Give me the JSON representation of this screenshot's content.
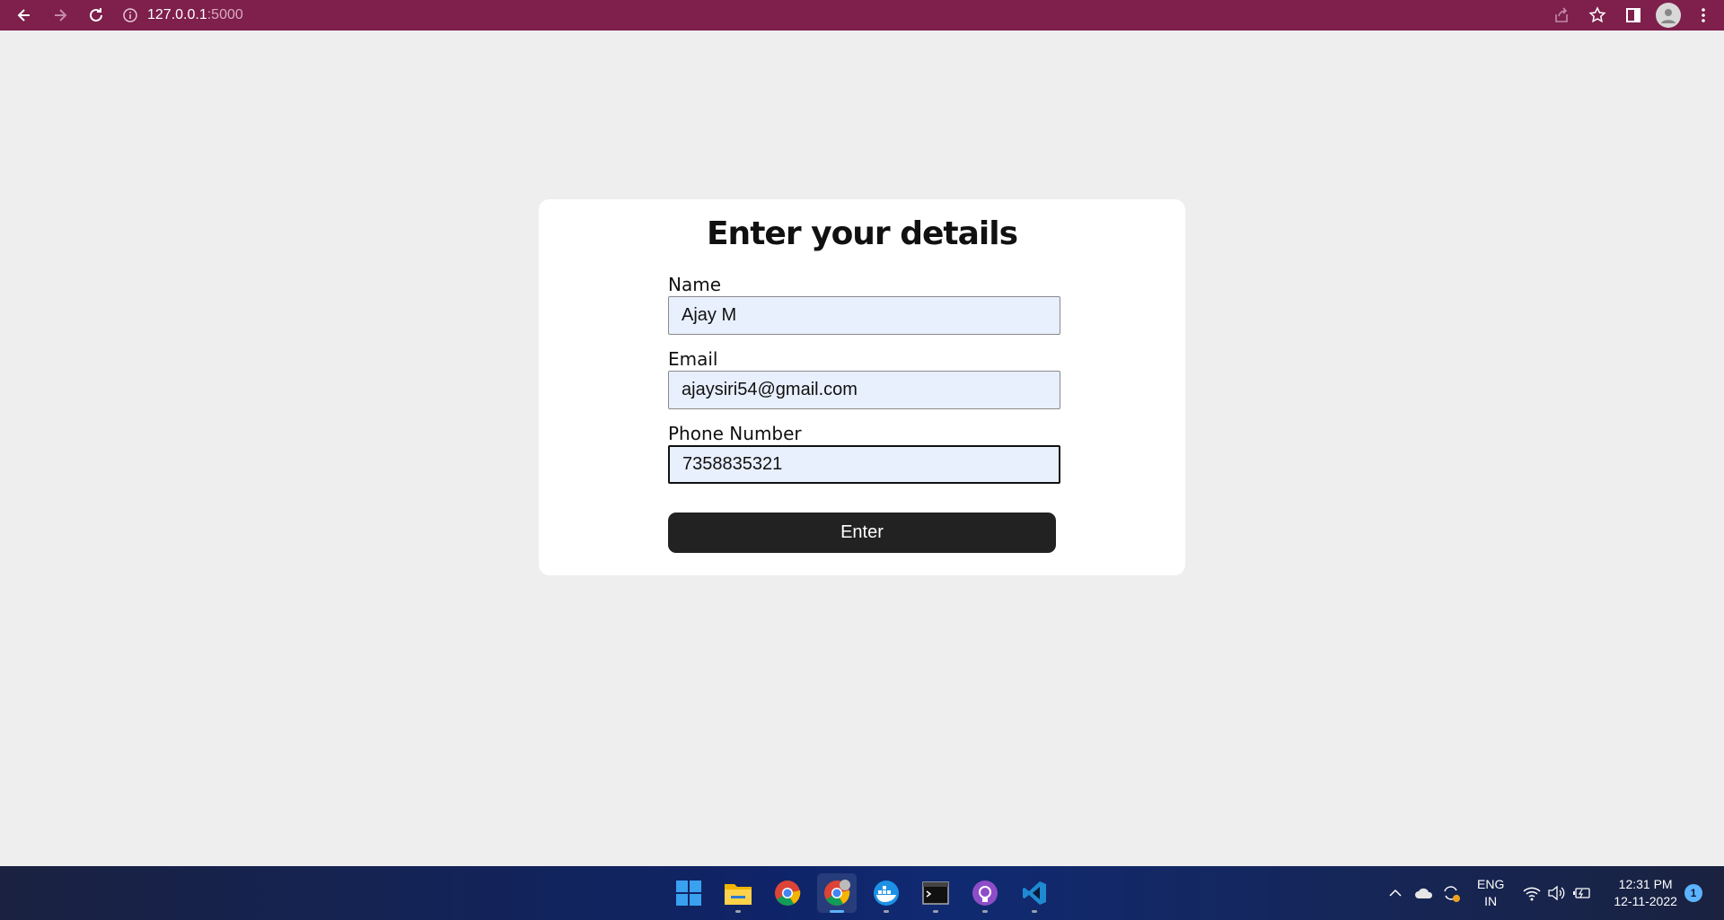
{
  "browser": {
    "url_host": "127.0.0.1",
    "url_port": ":5000"
  },
  "form": {
    "title": "Enter your details",
    "fields": [
      {
        "label": "Name",
        "value": "Ajay M"
      },
      {
        "label": "Email",
        "value": "ajaysiri54@gmail.com"
      },
      {
        "label": "Phone Number",
        "value": "7358835321"
      }
    ],
    "submit_label": "Enter"
  },
  "taskbar": {
    "apps": [
      "start-icon",
      "file-explorer-icon",
      "chrome-icon",
      "chrome-profile-icon",
      "docker-icon",
      "terminal-icon",
      "github-desktop-icon",
      "vscode-icon"
    ],
    "language_line1": "ENG",
    "language_line2": "IN",
    "time": "12:31 PM",
    "date": "12-11-2022",
    "notification_count": "1"
  },
  "colors": {
    "toolbar_bg": "#7e1f4c",
    "page_bg": "#eeeeee",
    "input_bg": "#e8f0fe",
    "button_bg": "#222222"
  }
}
